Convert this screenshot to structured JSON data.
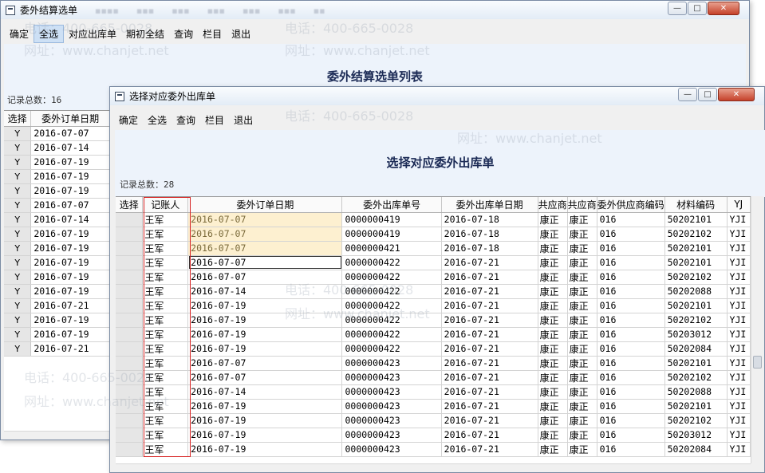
{
  "back_window": {
    "title": "委外结算选单",
    "menu": [
      "确定",
      "全选",
      "对应出库单",
      "期初全结",
      "查询",
      "栏目",
      "退出"
    ],
    "active_menu_index": 1,
    "list_title": "委外结算选单列表",
    "record_count": "记录总数：16",
    "columns": [
      "选择",
      "委外订单日期"
    ],
    "rows": [
      [
        "Y",
        "2016-07-07"
      ],
      [
        "Y",
        "2016-07-14"
      ],
      [
        "Y",
        "2016-07-19"
      ],
      [
        "Y",
        "2016-07-19"
      ],
      [
        "Y",
        "2016-07-19"
      ],
      [
        "Y",
        "2016-07-07"
      ],
      [
        "Y",
        "2016-07-14"
      ],
      [
        "Y",
        "2016-07-19"
      ],
      [
        "Y",
        "2016-07-19"
      ],
      [
        "Y",
        "2016-07-19"
      ],
      [
        "Y",
        "2016-07-19"
      ],
      [
        "Y",
        "2016-07-19"
      ],
      [
        "Y",
        "2016-07-21"
      ],
      [
        "Y",
        "2016-07-19"
      ],
      [
        "Y",
        "2016-07-19"
      ],
      [
        "Y",
        "2016-07-21"
      ]
    ],
    "controls": {
      "minimize": "—",
      "maximize": "□",
      "close": "✕"
    }
  },
  "front_window": {
    "title": "选择对应委外出库单",
    "menu": [
      "确定",
      "全选",
      "查询",
      "栏目",
      "退出"
    ],
    "list_title": "选择对应委外出库单",
    "record_count": "记录总数：28",
    "columns": [
      "选择",
      "记账人",
      "委外订单日期",
      "委外出库单号",
      "委外出库单日期",
      "共应商",
      "共应商",
      "委外供应商编码",
      "材料编码",
      "YJ"
    ],
    "rows": [
      [
        "",
        "王军",
        "2016-07-07",
        "0000000419",
        "2016-07-18",
        "康正",
        "康正",
        "016",
        "50202101",
        "YJI"
      ],
      [
        "",
        "王军",
        "2016-07-07",
        "0000000419",
        "2016-07-18",
        "康正",
        "康正",
        "016",
        "50202102",
        "YJI"
      ],
      [
        "",
        "王军",
        "2016-07-07",
        "0000000421",
        "2016-07-18",
        "康正",
        "康正",
        "016",
        "50202101",
        "YJI"
      ],
      [
        "",
        "王军",
        "2016-07-07",
        "0000000422",
        "2016-07-21",
        "康正",
        "康正",
        "016",
        "50202101",
        "YJI"
      ],
      [
        "",
        "王军",
        "2016-07-07",
        "0000000422",
        "2016-07-21",
        "康正",
        "康正",
        "016",
        "50202102",
        "YJI"
      ],
      [
        "",
        "王军",
        "2016-07-14",
        "0000000422",
        "2016-07-21",
        "康正",
        "康正",
        "016",
        "50202088",
        "YJI"
      ],
      [
        "",
        "王军",
        "2016-07-19",
        "0000000422",
        "2016-07-21",
        "康正",
        "康正",
        "016",
        "50202101",
        "YJI"
      ],
      [
        "",
        "王军",
        "2016-07-19",
        "0000000422",
        "2016-07-21",
        "康正",
        "康正",
        "016",
        "50202102",
        "YJI"
      ],
      [
        "",
        "王军",
        "2016-07-19",
        "0000000422",
        "2016-07-21",
        "康正",
        "康正",
        "016",
        "50203012",
        "YJI"
      ],
      [
        "",
        "王军",
        "2016-07-19",
        "0000000422",
        "2016-07-21",
        "康正",
        "康正",
        "016",
        "50202084",
        "YJI"
      ],
      [
        "",
        "王军",
        "2016-07-07",
        "0000000423",
        "2016-07-21",
        "康正",
        "康正",
        "016",
        "50202101",
        "YJI"
      ],
      [
        "",
        "王军",
        "2016-07-07",
        "0000000423",
        "2016-07-21",
        "康正",
        "康正",
        "016",
        "50202102",
        "YJI"
      ],
      [
        "",
        "王军",
        "2016-07-14",
        "0000000423",
        "2016-07-21",
        "康正",
        "康正",
        "016",
        "50202088",
        "YJI"
      ],
      [
        "",
        "王军",
        "2016-07-19",
        "0000000423",
        "2016-07-21",
        "康正",
        "康正",
        "016",
        "50202101",
        "YJI"
      ],
      [
        "",
        "王军",
        "2016-07-19",
        "0000000423",
        "2016-07-21",
        "康正",
        "康正",
        "016",
        "50202102",
        "YJI"
      ],
      [
        "",
        "王军",
        "2016-07-19",
        "0000000423",
        "2016-07-21",
        "康正",
        "康正",
        "016",
        "50203012",
        "YJI"
      ],
      [
        "",
        "王军",
        "2016-07-19",
        "0000000423",
        "2016-07-21",
        "康正",
        "康正",
        "016",
        "50202084",
        "YJI"
      ]
    ],
    "highlighted_rows": [
      0,
      1,
      2
    ],
    "focused_row": 3,
    "controls": {
      "minimize": "—",
      "maximize": "□",
      "close": "✕"
    }
  },
  "watermark": {
    "phone": "电话：400-665-0028",
    "site": "网址：www.chanjet.net"
  },
  "colors": {
    "highlight": "#fdf0d0",
    "redbox": "#d62020",
    "title_text": "#1b2a55"
  }
}
